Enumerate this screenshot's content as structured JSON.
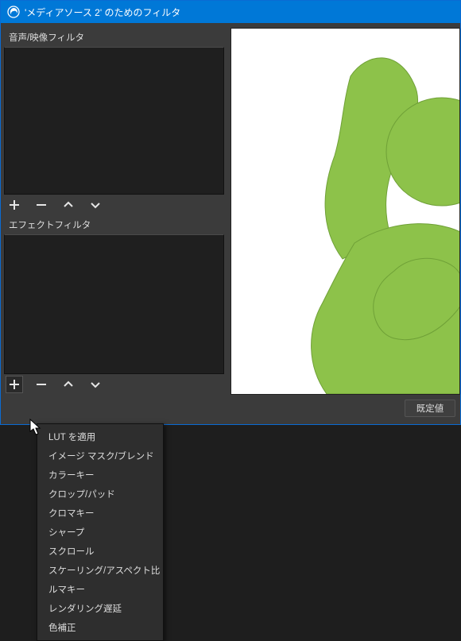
{
  "window": {
    "title": "'メディアソース 2' のためのフィルタ"
  },
  "left": {
    "audio_video_label": "音声/映像フィルタ",
    "effect_label": "エフェクトフィルタ"
  },
  "buttons": {
    "defaults": "既定値"
  },
  "context_menu": {
    "items": [
      "LUT を適用",
      "イメージ マスク/ブレンド",
      "カラーキー",
      "クロップ/パッド",
      "クロマキー",
      "シャープ",
      "スクロール",
      "スケーリング/アスペクト比",
      "ルマキー",
      "レンダリング遅延",
      "色補正"
    ]
  }
}
